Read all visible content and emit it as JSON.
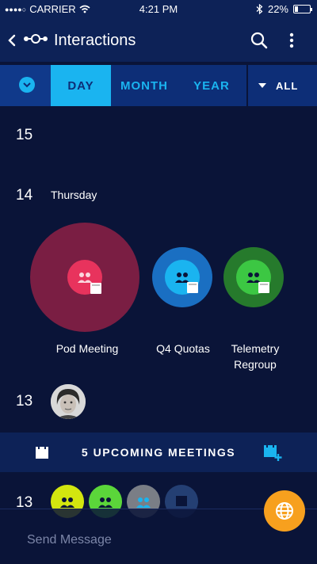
{
  "status": {
    "carrier": "CARRIER",
    "time": "4:21 PM",
    "battery": "22%",
    "battery_level": 0.22
  },
  "header": {
    "title": "Interactions"
  },
  "tabs": [
    {
      "label": "DAY",
      "active": true
    },
    {
      "label": "MONTH",
      "active": false
    },
    {
      "label": "YEAR",
      "active": false
    }
  ],
  "filter": {
    "label": "ALL"
  },
  "timeline": {
    "date_15": "15",
    "date_14": "14",
    "weekday_14": "Thursday",
    "date_13": "13",
    "date_13b": "13"
  },
  "meetings": [
    {
      "label": "Pod Meeting",
      "color": "#d42d55"
    },
    {
      "label": "Q4 Quotas",
      "color": "#1a6fc2"
    },
    {
      "label": "Telemetry Regroup",
      "color": "#36b23f"
    }
  ],
  "upcoming": {
    "label": "5 UPCOMING MEETINGS"
  },
  "small_bubbles": [
    {
      "color": "#d3e60f"
    },
    {
      "color": "#5bd63a"
    },
    {
      "color": "#7a7e86"
    },
    {
      "color": "#243f73"
    }
  ],
  "composer": {
    "placeholder": "Send Message"
  },
  "colors": {
    "accent": "#1ab4f0",
    "fab": "#f7a01e",
    "background": "#0a1438"
  }
}
